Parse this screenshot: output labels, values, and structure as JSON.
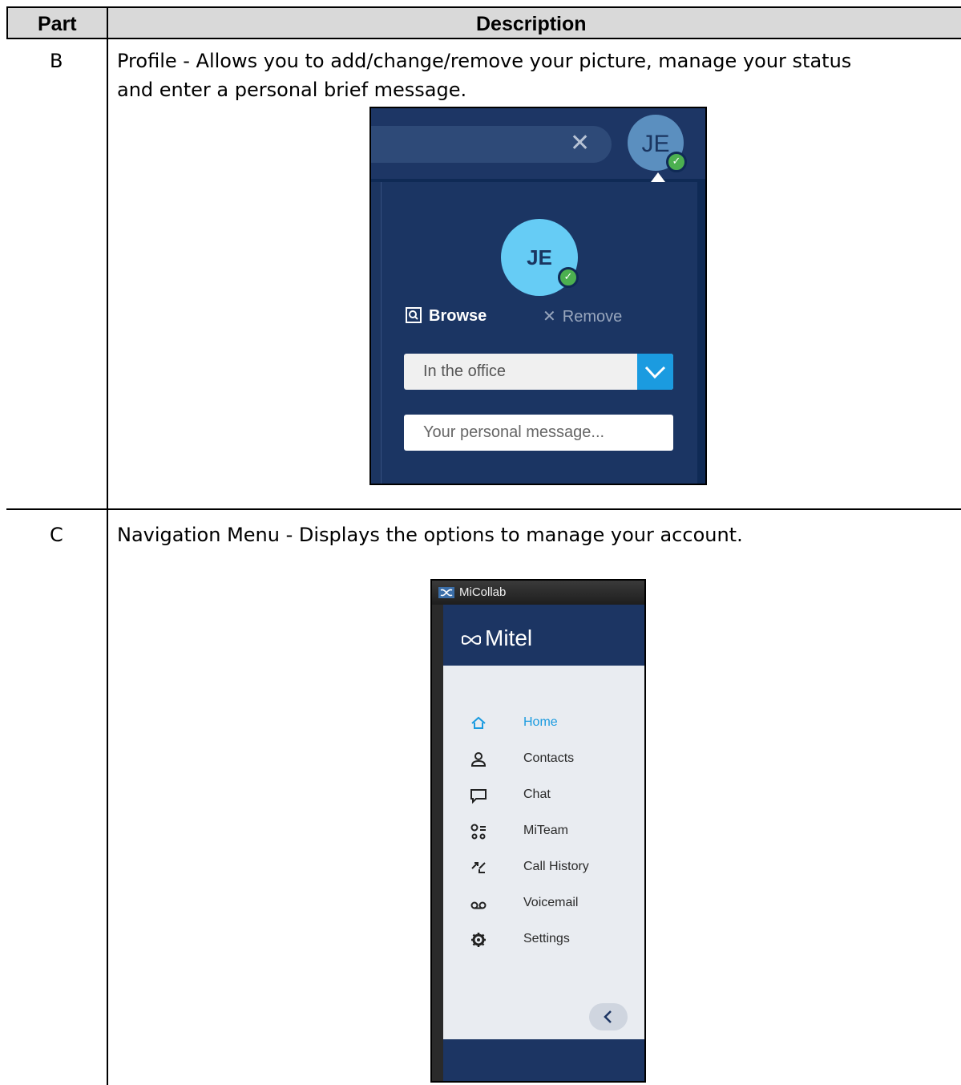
{
  "table": {
    "headers": {
      "part": "Part",
      "description": "Description"
    },
    "rows": [
      {
        "part": "B",
        "description_line1": "Profile - Allows you to add/change/remove your picture, manage your status",
        "description_line2": "and enter a personal brief message."
      },
      {
        "part": "C",
        "description_line1": "Navigation Menu - Displays the options to manage your account."
      }
    ]
  },
  "profile_screenshot": {
    "avatar_initials": "JE",
    "browse_label": "Browse",
    "remove_label": "Remove",
    "status_value": "In the office",
    "personal_message_placeholder": "Your personal message...",
    "colors": {
      "panel": "#1b3563",
      "avatar": "#66ccf5",
      "status_ok": "#4cb050",
      "accent": "#1b9be0"
    }
  },
  "nav_screenshot": {
    "window_title": "MiCollab",
    "logo_text": "Mitel",
    "items": [
      {
        "label": "Home",
        "icon": "home-icon",
        "active": true
      },
      {
        "label": "Contacts",
        "icon": "contacts-icon",
        "active": false
      },
      {
        "label": "Chat",
        "icon": "chat-icon",
        "active": false
      },
      {
        "label": "MiTeam",
        "icon": "miteam-icon",
        "active": false
      },
      {
        "label": "Call History",
        "icon": "call-history-icon",
        "active": false
      },
      {
        "label": "Voicemail",
        "icon": "voicemail-icon",
        "active": false
      },
      {
        "label": "Settings",
        "icon": "settings-icon",
        "active": false
      }
    ],
    "colors": {
      "header": "#1c3563",
      "background": "#e9ecf1",
      "active": "#1b9be0"
    }
  }
}
